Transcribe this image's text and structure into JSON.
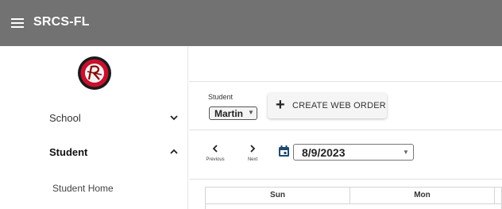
{
  "app": {
    "title": "SRCS-FL"
  },
  "colors": {
    "topbar": "#727272",
    "logo_red": "#c8102e"
  },
  "sidebar": {
    "items": [
      {
        "label": "School",
        "expanded": false,
        "icon": "chevron-down-icon"
      },
      {
        "label": "Student",
        "expanded": true,
        "icon": "chevron-up-icon"
      }
    ],
    "subitems": [
      {
        "label": "Student Home"
      }
    ]
  },
  "toolbar": {
    "student_label": "Student",
    "student_value": "Martin",
    "create_order_label": "CREATE WEB ORDER"
  },
  "date_nav": {
    "previous_label": "Previous",
    "next_label": "Next",
    "date_value": "8/9/2023"
  },
  "calendar": {
    "headers": [
      "Sun",
      "Mon"
    ]
  }
}
